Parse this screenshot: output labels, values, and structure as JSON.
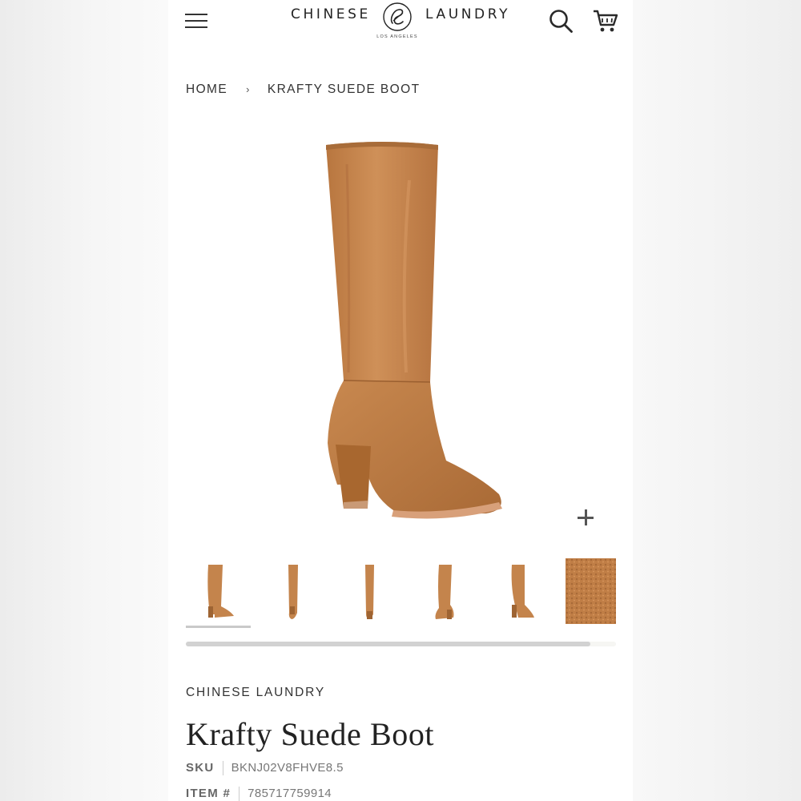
{
  "header": {
    "logo_left": "CHINESE",
    "logo_right": "LAUNDRY",
    "logo_sub": "LOS ANGELES",
    "menu_icon": "hamburger-menu-icon",
    "search_icon": "search-icon",
    "cart_icon": "cart-icon"
  },
  "breadcrumb": {
    "home": "HOME",
    "separator": "›",
    "current": "KRAFTY SUEDE BOOT"
  },
  "gallery": {
    "zoom_icon": "plus-icon",
    "thumbnails": [
      "boot-side-view",
      "boot-front-view",
      "boot-back-view",
      "boot-angle-view",
      "boot-pair-view",
      "suede-texture-swatch"
    ],
    "active_index": 0,
    "scroll_fraction": 0.94
  },
  "product": {
    "brand": "CHINESE LAUNDRY",
    "title": "Krafty Suede Boot",
    "sku_label": "SKU",
    "sku_value": "BKNJ02V8FHVE8.5",
    "item_label": "ITEM #",
    "item_value": "785717759914"
  },
  "colors": {
    "suede": "#c4844c",
    "suede_dark": "#9e6433",
    "text": "#2a2a2a"
  }
}
